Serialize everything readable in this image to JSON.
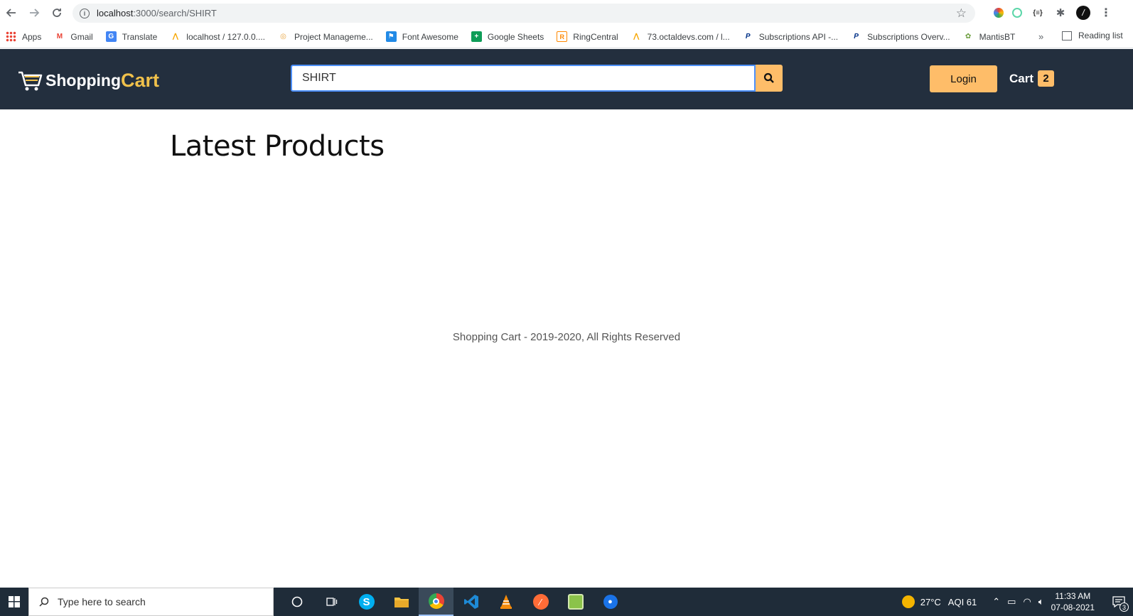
{
  "browser": {
    "url_host": "localhost",
    "url_path": ":3000/search/SHIRT",
    "bookmarks": [
      {
        "label": "Apps",
        "icon": "apps-grid-icon",
        "color": "#ea4335"
      },
      {
        "label": "Gmail",
        "icon": "gmail-icon",
        "color": "#ea4335"
      },
      {
        "label": "Translate",
        "icon": "translate-icon",
        "color": "#4285f4"
      },
      {
        "label": "localhost / 127.0.0....",
        "icon": "phpmyadmin-icon",
        "color": "#f7a600"
      },
      {
        "label": "Project Manageme...",
        "icon": "project-icon",
        "color": "#e8a33d"
      },
      {
        "label": "Font Awesome",
        "icon": "font-awesome-icon",
        "color": "#228ae6"
      },
      {
        "label": "Google Sheets",
        "icon": "sheets-icon",
        "color": "#0f9d58"
      },
      {
        "label": "RingCentral",
        "icon": "ringcentral-icon",
        "color": "#f80"
      },
      {
        "label": "73.octaldevs.com / l...",
        "icon": "phpmyadmin-icon",
        "color": "#f7a600"
      },
      {
        "label": "Subscriptions API -...",
        "icon": "paypal-icon",
        "color": "#003087"
      },
      {
        "label": "Subscriptions Overv...",
        "icon": "paypal-icon",
        "color": "#003087"
      },
      {
        "label": "MantisBT",
        "icon": "mantis-icon",
        "color": "#6a9c3a"
      }
    ],
    "more_label": "»",
    "reading_list_label": "Reading list"
  },
  "header": {
    "brand_part1": "Shopping",
    "brand_part2": "Cart",
    "search_value": "SHIRT",
    "login_label": "Login",
    "cart_label": "Cart",
    "cart_count": "2"
  },
  "main": {
    "title": "Latest Products"
  },
  "footer": {
    "text": "Shopping Cart - 2019-2020, All Rights Reserved"
  },
  "taskbar": {
    "search_placeholder": "Type here to search",
    "weather": "27°C",
    "aqi": "AQI 61",
    "time": "11:33 AM",
    "date": "07-08-2021",
    "notification_count": "3"
  }
}
